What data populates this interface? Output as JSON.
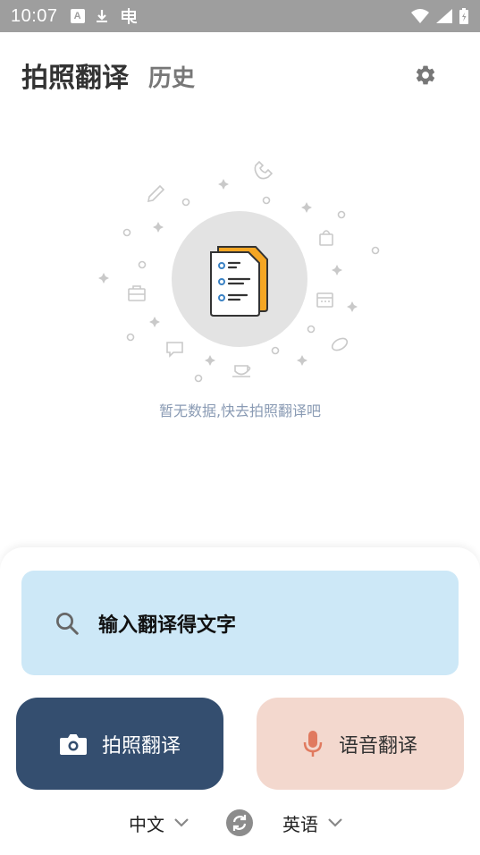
{
  "status_bar": {
    "time": "10:07",
    "icons": [
      "notification-a-icon",
      "download-icon",
      "app-icon",
      "wifi-icon",
      "signal-icon",
      "battery-charging-icon"
    ]
  },
  "header": {
    "tab_active": "拍照翻译",
    "tab_history": "历史",
    "settings_icon": "gear-icon"
  },
  "empty_state": {
    "message": "暂无数据,快去拍照翻译吧",
    "illustration_icon": "document-icon"
  },
  "search": {
    "placeholder": "输入翻译得文字",
    "icon": "search-icon"
  },
  "actions": {
    "photo_label": "拍照翻译",
    "voice_label": "语音翻译"
  },
  "languages": {
    "source": "中文",
    "target": "英语"
  },
  "colors": {
    "status_bar": "#9e9e9e",
    "search_bg": "#cde8f7",
    "photo_btn": "#344e6f",
    "voice_btn": "#f3d8ce",
    "mic_accent": "#e07a5f",
    "doc_accent": "#f5a623"
  }
}
